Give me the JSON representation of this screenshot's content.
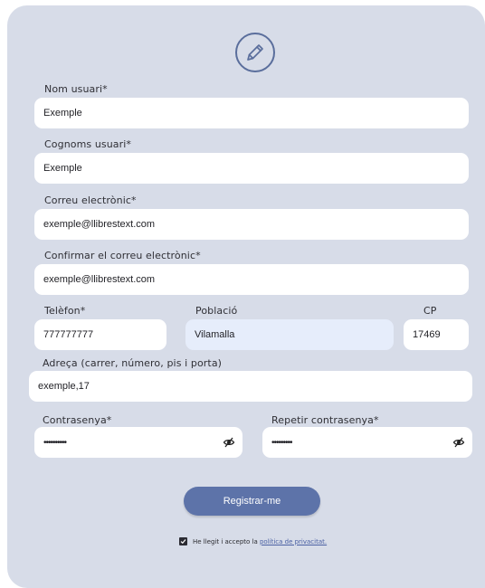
{
  "form": {
    "logo_icon": "pencil-icon",
    "name": {
      "label": "Nom usuari*",
      "value": "Exemple"
    },
    "surname": {
      "label": "Cognoms usuari*",
      "value": "Exemple"
    },
    "email": {
      "label": "Correu electrònic*",
      "value": "exemple@llibrestext.com"
    },
    "email_confirm": {
      "label": "Confirmar el correu electrònic*",
      "value": "exemple@llibrestext.com"
    },
    "phone": {
      "label": "Telèfon*",
      "value": "777777777"
    },
    "town": {
      "label": "Població",
      "value": "Vilamalla"
    },
    "postcode": {
      "label": "CP",
      "value": "17469"
    },
    "address": {
      "label": "Adreça (carrer, número, pis i porta)",
      "value": "exemple,17"
    },
    "password": {
      "label": "Contrasenya*",
      "value": "••••••••••"
    },
    "password_repeat": {
      "label": "Repetir contrasenya*",
      "value": "•••••••••"
    },
    "submit_label": "Registrar-me",
    "accept_text": "He llegit i accepto la ",
    "privacy_link": "política de privacitat."
  },
  "colors": {
    "card": "#d7dce8",
    "button": "#5d73a9",
    "tinted_field": "#e6edfb"
  }
}
